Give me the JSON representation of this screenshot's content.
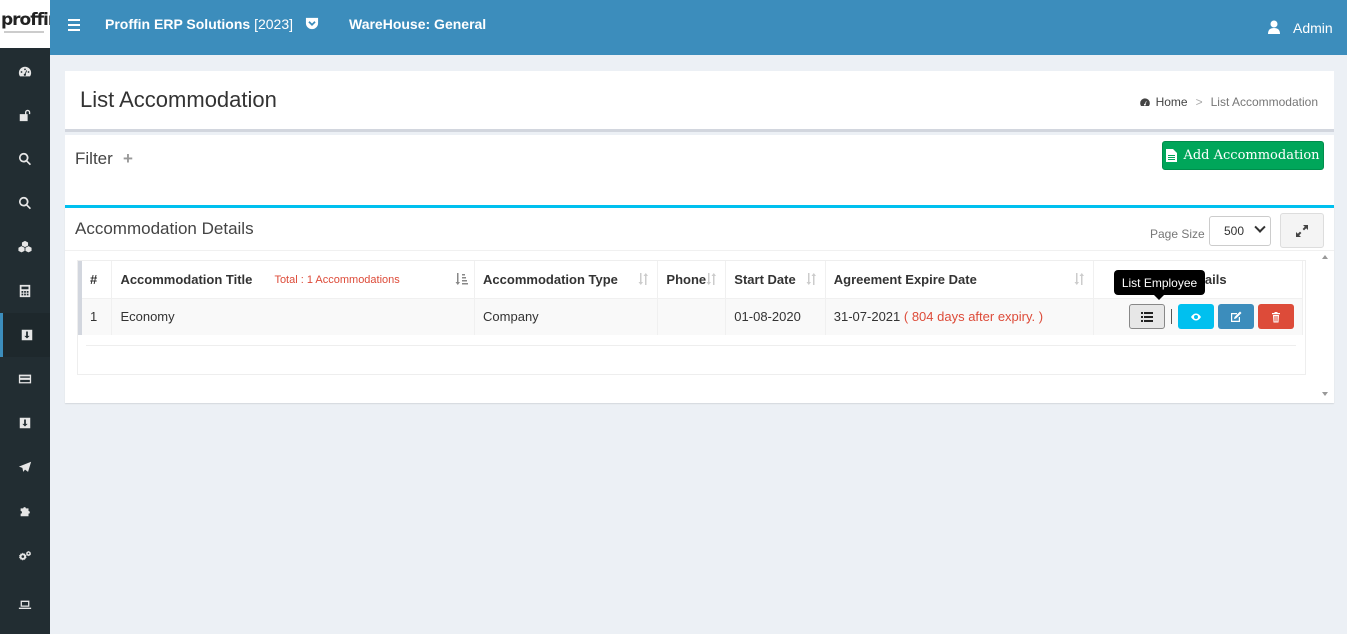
{
  "header": {
    "brand": "Proffin ERP Solutions",
    "year": "[2023]",
    "warehouse": "WareHouse: General",
    "user": "Admin"
  },
  "logo": {
    "text": "proffin"
  },
  "sidebar": {
    "icons": [
      "dashboard-icon",
      "unlock-icon",
      "search-icon",
      "search-icon",
      "cubes-icon",
      "calculator-icon",
      "download-icon",
      "credit-card-icon",
      "download-icon",
      "plane-icon",
      "puzzle-icon",
      "cogs-icon",
      "laptop-icon"
    ],
    "active_index": 6
  },
  "page": {
    "title": "List Accommodation",
    "breadcrumb": {
      "home": "Home",
      "separator": ">",
      "current": "List Accommodation"
    }
  },
  "filter": {
    "label": "Filter",
    "toggle": "+",
    "add_button": "Add Accommodation"
  },
  "details": {
    "title": "Accommodation Details",
    "page_size_label": "Page Size",
    "page_size_value": "500",
    "table": {
      "headers": [
        "#",
        "Accommodation Title",
        "Accommodation Type",
        "Phone",
        "Start Date",
        "Agreement Expire Date",
        "Details"
      ],
      "total_label": "Total : 1 Accommodations",
      "rows": [
        {
          "num": "1",
          "title": "Economy",
          "type": "Company",
          "phone": "",
          "start_date": "01-08-2020",
          "expire_date": "31-07-2021",
          "expiry_note": "( 804 days after expiry. )"
        }
      ]
    }
  },
  "tooltip": {
    "text": "List Employee"
  },
  "colors": {
    "header": "#3c8dbc",
    "sidebar": "#222d32",
    "add_button": "#00a65a",
    "box_border": "#00c0ef",
    "danger": "#dd4b39",
    "info": "#00c0ef",
    "primary": "#3c8dbc"
  }
}
